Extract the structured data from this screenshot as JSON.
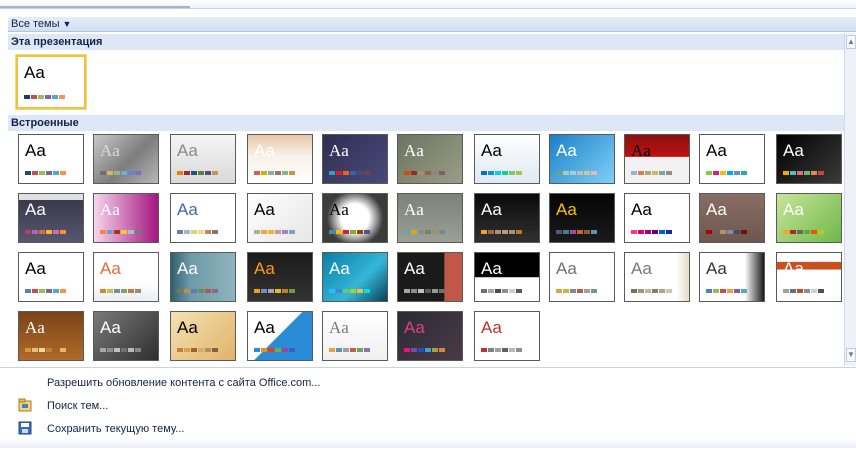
{
  "filter": {
    "label": "Все темы",
    "caret": "▼"
  },
  "sections": {
    "this_presentation": "Эта презентация",
    "builtin": "Встроенные"
  },
  "sample_text": "Aa",
  "themes": [
    {
      "id": "current",
      "bg": "#ffffff",
      "fg": "#000000",
      "serif": false,
      "sw": [
        "#1f3a6b",
        "#c0504d",
        "#9bbb59",
        "#8064a2",
        "#4bacc6",
        "#f79646"
      ]
    },
    {
      "id": "office",
      "bg": "#ffffff",
      "fg": "#000000",
      "serif": false,
      "sw": [
        "#1f497d",
        "#c0504d",
        "#9bbb59",
        "#8064a2",
        "#4bacc6",
        "#f79646"
      ]
    },
    {
      "id": "apex",
      "bg": "linear-gradient(135deg,#c9c9c9,#7d7d7d 55%,#b7b7b7)",
      "fg": "#d9d9d9",
      "serif": true,
      "sw": [
        "#6f6f74",
        "#ceb966",
        "#9cb084",
        "#6bb1c9",
        "#6585cf",
        "#7e6bc9"
      ]
    },
    {
      "id": "aspect",
      "bg": "linear-gradient(#f5f5f5,#d9d9d9)",
      "fg": "#8a8a8a",
      "serif": false,
      "sw": [
        "#f07f09",
        "#9f2936",
        "#1b587c",
        "#4e8542",
        "#604878",
        "#c19859"
      ]
    },
    {
      "id": "civic",
      "bg": "linear-gradient(180deg,#e9c6a8,#f7f2ea 45%,#ffffff)",
      "fg": "#ffffff",
      "serif": false,
      "sw": [
        "#d16349",
        "#ccb400",
        "#8cadae",
        "#8c7b70",
        "#8fb08c",
        "#d19049"
      ]
    },
    {
      "id": "concourse",
      "bg": "linear-gradient(135deg,#2e2e52,#4a4a7a)",
      "fg": "#ffffff",
      "serif": true,
      "sw": [
        "#2da2bf",
        "#da1f28",
        "#eb641b",
        "#39639d",
        "#474b78",
        "#7d3c4a"
      ]
    },
    {
      "id": "equity",
      "bg": "linear-gradient(135deg,#6d735f,#9a9e88)",
      "fg": "#ffffff",
      "serif": true,
      "sw": [
        "#d34817",
        "#9b2d1f",
        "#a28e6a",
        "#956251",
        "#918485",
        "#855d5d"
      ]
    },
    {
      "id": "flow",
      "bg": "linear-gradient(#ffffff,#dfe8f4)",
      "fg": "#000000",
      "serif": false,
      "sw": [
        "#0f6fc6",
        "#009dd9",
        "#0bd0d9",
        "#10cf9b",
        "#7cca62",
        "#a5c249"
      ]
    },
    {
      "id": "foundry",
      "bg": "linear-gradient(135deg,#1b80c8,#7fd0f6)",
      "fg": "#ffffff",
      "serif": false,
      "sw": [
        "#72a376",
        "#b0ccb0",
        "#a8cdd7",
        "#c0beaf",
        "#cec597",
        "#e8b7b7"
      ]
    },
    {
      "id": "median",
      "bg": "linear-gradient(#8a0f0f,#c01010 45%,#f2f2f2 46%)",
      "fg": "#000000",
      "serif": true,
      "sw": [
        "#94b6d2",
        "#dd8047",
        "#a5ab81",
        "#d8b25c",
        "#7ba79d",
        "#968c8c"
      ]
    },
    {
      "id": "metro",
      "bg": "#ffffff",
      "fg": "#000000",
      "serif": false,
      "sw": [
        "#7fd13b",
        "#ea157a",
        "#feb80a",
        "#00addc",
        "#738ac8",
        "#1ab39f"
      ]
    },
    {
      "id": "module",
      "bg": "linear-gradient(135deg,#000000,#3b3b3b)",
      "fg": "#ffffff",
      "serif": false,
      "sw": [
        "#f0ad00",
        "#60b5cc",
        "#e66c7d",
        "#6bb76d",
        "#e88651",
        "#c64847"
      ]
    },
    {
      "id": "opulent",
      "bg": "linear-gradient(#e0e0e0 0,#e0e0e0 12%,#3a3a4a 13%,#565670)",
      "fg": "#ffffff",
      "serif": false,
      "sw": [
        "#b83d68",
        "#ac66bb",
        "#de6c36",
        "#f9b639",
        "#cf6da4",
        "#fa8d3d"
      ]
    },
    {
      "id": "oriel",
      "bg": "linear-gradient(90deg,#f5d6ec,#a4157f)",
      "fg": "#ffffff",
      "serif": true,
      "sw": [
        "#fe8637",
        "#7598d9",
        "#b32c16",
        "#f5cd2d",
        "#aebad5",
        "#777c84"
      ]
    },
    {
      "id": "origin",
      "bg": "#ffffff",
      "fg": "#3a6bb0",
      "serif": false,
      "sw": [
        "#727ca3",
        "#9fb8cd",
        "#d2da7a",
        "#fada7a",
        "#b88472",
        "#8e736a"
      ]
    },
    {
      "id": "paper",
      "bg": "linear-gradient(135deg,#ffffff,#e6e6e6)",
      "fg": "#000000",
      "serif": false,
      "sw": [
        "#a5b592",
        "#f3a447",
        "#e7bc29",
        "#d092a7",
        "#9c85c0",
        "#809ec2"
      ]
    },
    {
      "id": "solstice",
      "bg": "radial-gradient(circle,#ffffff 35%,#3c3c3c 70%)",
      "fg": "#000000",
      "serif": true,
      "sw": [
        "#3891a7",
        "#feb80a",
        "#c32d2e",
        "#84aa33",
        "#964305",
        "#475a8d"
      ]
    },
    {
      "id": "technic",
      "bg": "linear-gradient(#7b8278,#9aa096)",
      "fg": "#ffffff",
      "serif": true,
      "sw": [
        "#6ea0b0",
        "#ccaf0a",
        "#8d89a4",
        "#748560",
        "#9e9273",
        "#7e848d"
      ]
    },
    {
      "id": "trek",
      "bg": "linear-gradient(#0a0a0a,#303030)",
      "fg": "#ffffff",
      "serif": false,
      "sw": [
        "#f0a22e",
        "#a5644e",
        "#b58b80",
        "#c3986d",
        "#a19574",
        "#c17529"
      ]
    },
    {
      "id": "urban",
      "bg": "linear-gradient(#050505,#1a1a1a)",
      "fg": "#ffc000",
      "serif": false,
      "sw": [
        "#53548a",
        "#438086",
        "#a04da3",
        "#c4652d",
        "#8b5d3d",
        "#5c92b5"
      ]
    },
    {
      "id": "verve",
      "bg": "#ffffff",
      "fg": "#000000",
      "serif": false,
      "sw": [
        "#ff388c",
        "#e40059",
        "#9c007f",
        "#68007f",
        "#005bd3",
        "#00349e"
      ]
    },
    {
      "id": "newsprint",
      "bg": "linear-gradient(#8a6d64,#6c5850)",
      "fg": "#ffffff",
      "serif": false,
      "sw": [
        "#ad0101",
        "#726056",
        "#ac956e",
        "#808da9",
        "#424e5b",
        "#730e00"
      ]
    },
    {
      "id": "pushpin",
      "bg": "linear-gradient(135deg,#c7e59a,#6fb84a)",
      "fg": "#ffffff",
      "serif": false,
      "sw": [
        "#fda023",
        "#aa2b1e",
        "#71685c",
        "#64a73b",
        "#eb5605",
        "#b9ca1a"
      ]
    },
    {
      "id": "flow2",
      "bg": "#ffffff",
      "fg": "#000000",
      "serif": false,
      "sw": [
        "#4f81bd",
        "#c0504d",
        "#9bbb59",
        "#8064a2",
        "#4bacc6",
        "#f79646"
      ]
    },
    {
      "id": "aspect2",
      "bg": "linear-gradient(#ffffff,#ffffff 60%,#e9eef2)",
      "fg": "#e06b3c",
      "serif": false,
      "sw": [
        "#d6862d",
        "#d0be40",
        "#7a8c8e",
        "#84a35b",
        "#be7c51",
        "#998c73"
      ]
    },
    {
      "id": "hardcover",
      "bg": "linear-gradient(90deg,#2f5f6f,#6d9aa8 30%,#8fb4bd)",
      "fg": "#ffffff",
      "serif": false,
      "sw": [
        "#7b7a51",
        "#bd8e4c",
        "#5b7ab3",
        "#6d8c4f",
        "#a95e4c",
        "#8a6a85"
      ]
    },
    {
      "id": "trek2",
      "bg": "linear-gradient(#1b1b1b,#333333)",
      "fg": "#ff9a1a",
      "serif": false,
      "sw": [
        "#f59e00",
        "#6d8dcc",
        "#a5a5a5",
        "#e6b91e",
        "#c27d2e",
        "#749b3a"
      ]
    },
    {
      "id": "waveform",
      "bg": "linear-gradient(135deg,#0a7fa8,#35b6d7 60%,#083f5a)",
      "fg": "#ffffff",
      "serif": false,
      "sw": [
        "#31b6fd",
        "#4584d3",
        "#5bd078",
        "#a5d028",
        "#f5c040",
        "#05e0db"
      ]
    },
    {
      "id": "foundry2",
      "bg": "linear-gradient(90deg,#1a1a1a 72%,#c0584a 73%)",
      "fg": "#ffffff",
      "serif": false,
      "sw": [
        "#a5a5a5",
        "#8c8c8c",
        "#c0c0c0",
        "#5a5a5a",
        "#969696",
        "#707070"
      ]
    },
    {
      "id": "black-tie",
      "bg": "linear-gradient(#000000,#000000 50%,#ffffff 51%)",
      "fg": "#ffffff",
      "serif": false,
      "sw": [
        "#6f6f74",
        "#a5a5a5",
        "#4b4b4b",
        "#8c8c8c",
        "#d0d0d0",
        "#5a5a5a"
      ]
    },
    {
      "id": "essential",
      "bg": "#ffffff",
      "fg": "#6f6f6f",
      "serif": false,
      "sw": [
        "#e8a23a",
        "#b7bf4a",
        "#7c8c99",
        "#c45a3b",
        "#9f9f9f",
        "#6b9d76"
      ]
    },
    {
      "id": "horizon",
      "bg": "linear-gradient(90deg,#ffffff 80%,#e6dcc6)",
      "fg": "#7a7a7a",
      "serif": false,
      "sw": [
        "#7a6e5c",
        "#a0947c",
        "#c0b49c",
        "#8c7c66",
        "#b2a28a",
        "#d0c4ac"
      ]
    },
    {
      "id": "sky",
      "bg": "linear-gradient(90deg,#ffffff 70%,#1a1a1a)",
      "fg": "#333333",
      "serif": false,
      "sw": [
        "#4f81bd",
        "#9bbb59",
        "#c0504d",
        "#f79646",
        "#8064a2",
        "#4bacc6"
      ]
    },
    {
      "id": "executive",
      "bg": "linear-gradient(#ffffff 18%,#cc4f20 19%,#cc4f20 34%,#ffffff 35%)",
      "fg": "#ffffff",
      "serif": false,
      "sw": [
        "#a0a0a0",
        "#6f6f6f",
        "#c04f20",
        "#8c8c8c",
        "#d0d0d0",
        "#505050"
      ]
    },
    {
      "id": "austin",
      "bg": "linear-gradient(#7a4416,#b26a2a)",
      "fg": "#ffffff",
      "serif": true,
      "sw": [
        "#d09a3a",
        "#e0c080",
        "#f0d8a0",
        "#c08040",
        "#a06030",
        "#e8b860"
      ]
    },
    {
      "id": "clarity",
      "bg": "linear-gradient(135deg,#7a7a7a,#2e2e2e)",
      "fg": "#ffffff",
      "serif": false,
      "sw": [
        "#a8a8a8",
        "#909090",
        "#c0c0c0",
        "#707070",
        "#b8b8b8",
        "#888888"
      ]
    },
    {
      "id": "elemental",
      "bg": "linear-gradient(135deg,#f5e1b2,#e0b46a)",
      "fg": "#000000",
      "serif": false,
      "sw": [
        "#c08040",
        "#e0a040",
        "#a06030",
        "#d0b070",
        "#b09060",
        "#806040"
      ]
    },
    {
      "id": "angles",
      "bg": "linear-gradient(135deg,#ffffff 48%,#2a8bd6 49%)",
      "fg": "#000000",
      "serif": false,
      "sw": [
        "#2a8bd6",
        "#f08c1a",
        "#e04020",
        "#70b040",
        "#a040a0",
        "#3060c0"
      ]
    },
    {
      "id": "pinstripe",
      "bg": "linear-gradient(#ffffff,#f0f0f0)",
      "fg": "#7a7a7a",
      "serif": true,
      "sw": [
        "#e8a040",
        "#6090c0",
        "#a0a0a0",
        "#c06040",
        "#70a060",
        "#9070b0"
      ]
    },
    {
      "id": "spring",
      "bg": "linear-gradient(135deg,#2b2b35,#4a3a48)",
      "fg": "#e04080",
      "serif": false,
      "sw": [
        "#ea157a",
        "#7050a0",
        "#2050c0",
        "#40a0d0",
        "#a0a040",
        "#e08040"
      ]
    },
    {
      "id": "crimson",
      "bg": "#ffffff",
      "fg": "#c0302a",
      "serif": false,
      "sw": [
        "#c0302a",
        "#808080",
        "#a0a0a0",
        "#606060",
        "#b8b8b8",
        "#909090"
      ]
    }
  ],
  "menu": {
    "enable_updates": "Разрешить обновление контента с сайта Office.com...",
    "browse": "Поиск тем...",
    "save": "Сохранить текущую тему..."
  }
}
